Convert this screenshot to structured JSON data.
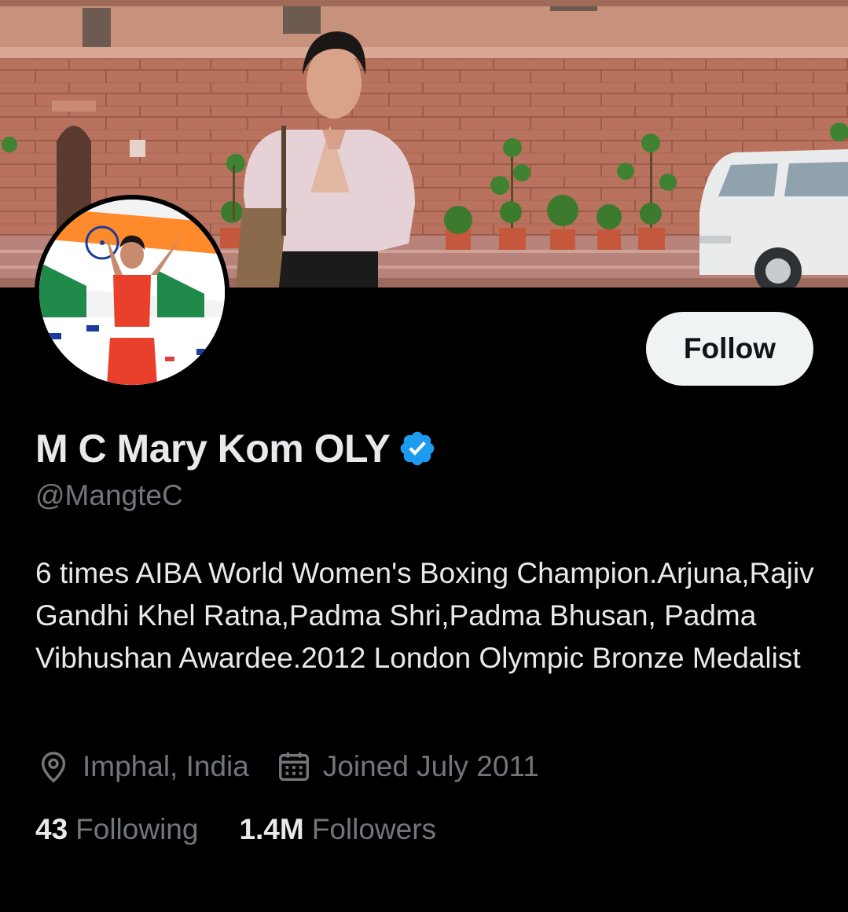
{
  "profile": {
    "display_name": "M C Mary Kom OLY",
    "handle": "@MangteC",
    "bio": "6 times AIBA World Women's Boxing Champion.Arjuna,Rajiv Gandhi Khel Ratna,Padma Shri,Padma Bhusan, Padma Vibhushan Awardee.2012 London Olympic Bronze Medalist",
    "verified_icon": "verified-badge-icon",
    "location": "Imphal, India",
    "location_icon": "location-pin-icon",
    "joined": "Joined July 2011",
    "joined_icon": "calendar-icon"
  },
  "actions": {
    "follow_label": "Follow"
  },
  "stats": {
    "following_count": "43",
    "following_label": "Following",
    "followers_count": "1.4M",
    "followers_label": "Followers"
  },
  "colors": {
    "background": "#000000",
    "text_primary": "#e7e9ea",
    "text_secondary": "#71767b",
    "verified_blue": "#1d9bf0",
    "follow_button_bg": "#eff3f4",
    "follow_button_text": "#0f1419"
  }
}
